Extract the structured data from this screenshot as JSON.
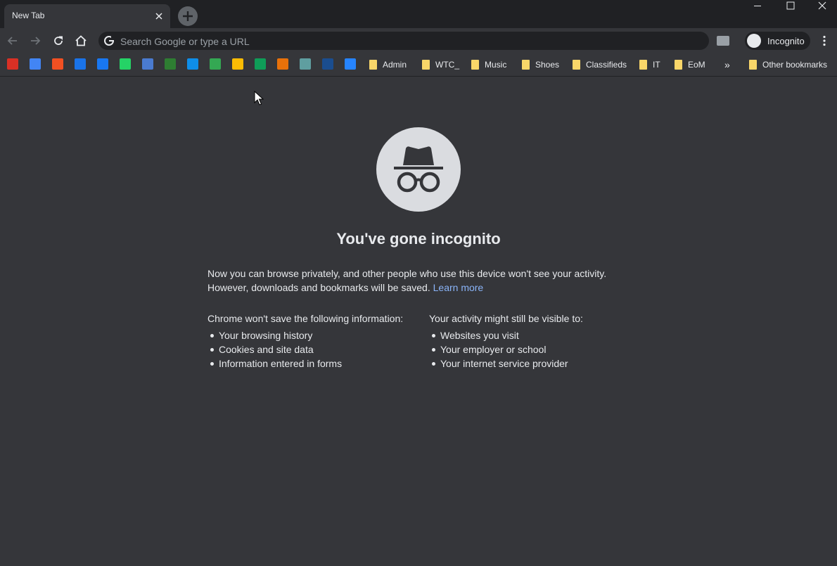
{
  "tab": {
    "title": "New Tab"
  },
  "omnibox": {
    "placeholder": "Search Google or type a URL"
  },
  "profile": {
    "label": "Incognito"
  },
  "bookmarks": {
    "icons": [
      {
        "name": "mail-icon",
        "color": "#d93025"
      },
      {
        "name": "task-icon",
        "color": "#4285f4"
      },
      {
        "name": "windows-icon",
        "color": "#f25022"
      },
      {
        "name": "calendar-icon",
        "color": "#1a73e8"
      },
      {
        "name": "facebook-icon",
        "color": "#1877f2"
      },
      {
        "name": "whatsapp-icon",
        "color": "#25d366"
      },
      {
        "name": "remote-icon",
        "color": "#4a7bd0"
      },
      {
        "name": "rss-icon",
        "color": "#2e7d32"
      },
      {
        "name": "teamviewer-icon",
        "color": "#0e8ee9"
      },
      {
        "name": "drive-icon",
        "color": "#34a853"
      },
      {
        "name": "keep-icon",
        "color": "#fbbc04"
      },
      {
        "name": "sheets-icon",
        "color": "#0f9d58"
      },
      {
        "name": "chrome-web-icon",
        "color": "#e8710a"
      },
      {
        "name": "image-icon",
        "color": "#5f9ea0"
      },
      {
        "name": "globe-icon",
        "color": "#1a4d8f"
      },
      {
        "name": "jira-icon",
        "color": "#2684ff"
      }
    ],
    "folders": [
      "Admin",
      "WTC_",
      "Music",
      "Shoes",
      "Classifieds",
      "IT",
      "EoM"
    ],
    "overflow": "»",
    "other": "Other bookmarks"
  },
  "page": {
    "heading": "You've gone incognito",
    "para_line1": "Now you can browse privately, and other people who use this device won't see your activity.",
    "para_line2": "However, downloads and bookmarks will be saved.",
    "learn_more": "Learn more",
    "left_title": "Chrome won't save the following information:",
    "left_items": [
      "Your browsing history",
      "Cookies and site data",
      "Information entered in forms"
    ],
    "right_title": "Your activity might still be visible to:",
    "right_items": [
      "Websites you visit",
      "Your employer or school",
      "Your internet service provider"
    ]
  }
}
